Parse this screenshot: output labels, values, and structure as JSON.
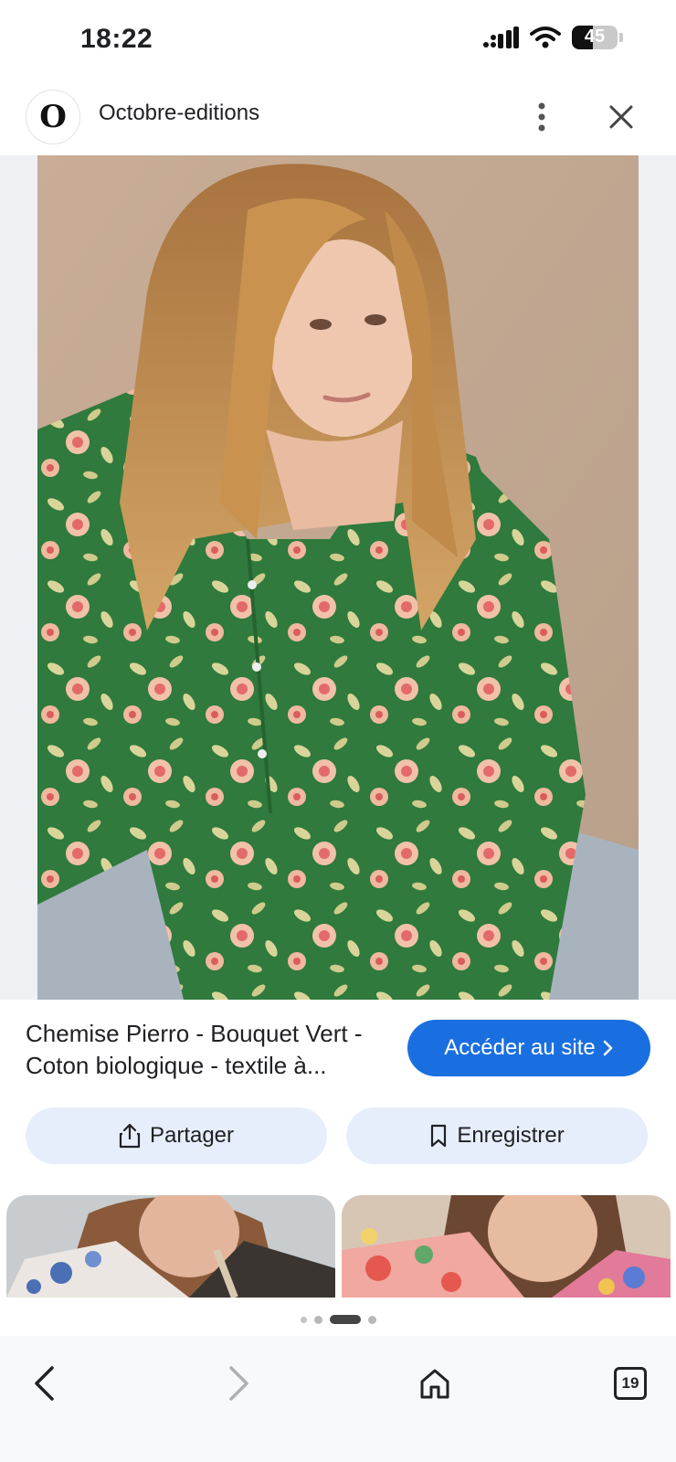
{
  "status_bar": {
    "time": "18:22",
    "battery": 45,
    "battery_label": "45",
    "icons": [
      "cellular-signal-icon",
      "wifi-icon",
      "battery-icon"
    ]
  },
  "header": {
    "site_logo_letter": "O",
    "site_name": "Octobre-editions",
    "icons": [
      "more-vertical-icon",
      "close-icon"
    ]
  },
  "product": {
    "title": "Chemise Pierro - Bouquet Vert - Coton biologique - textile à...",
    "visit_label": "Accéder au site",
    "share_label": "Partager",
    "save_label": "Enregistrer"
  },
  "carousel": {
    "page_count": 4,
    "active_index": 2
  },
  "bottom_nav": {
    "tab_count": "19",
    "icons": [
      "back-icon",
      "forward-icon",
      "home-icon",
      "tabs-icon"
    ]
  },
  "colors": {
    "accent": "#1a6fe0",
    "button_bg": "#e6eefb",
    "shirt_green": "#2f7a3c",
    "background": "#eef0f4"
  }
}
